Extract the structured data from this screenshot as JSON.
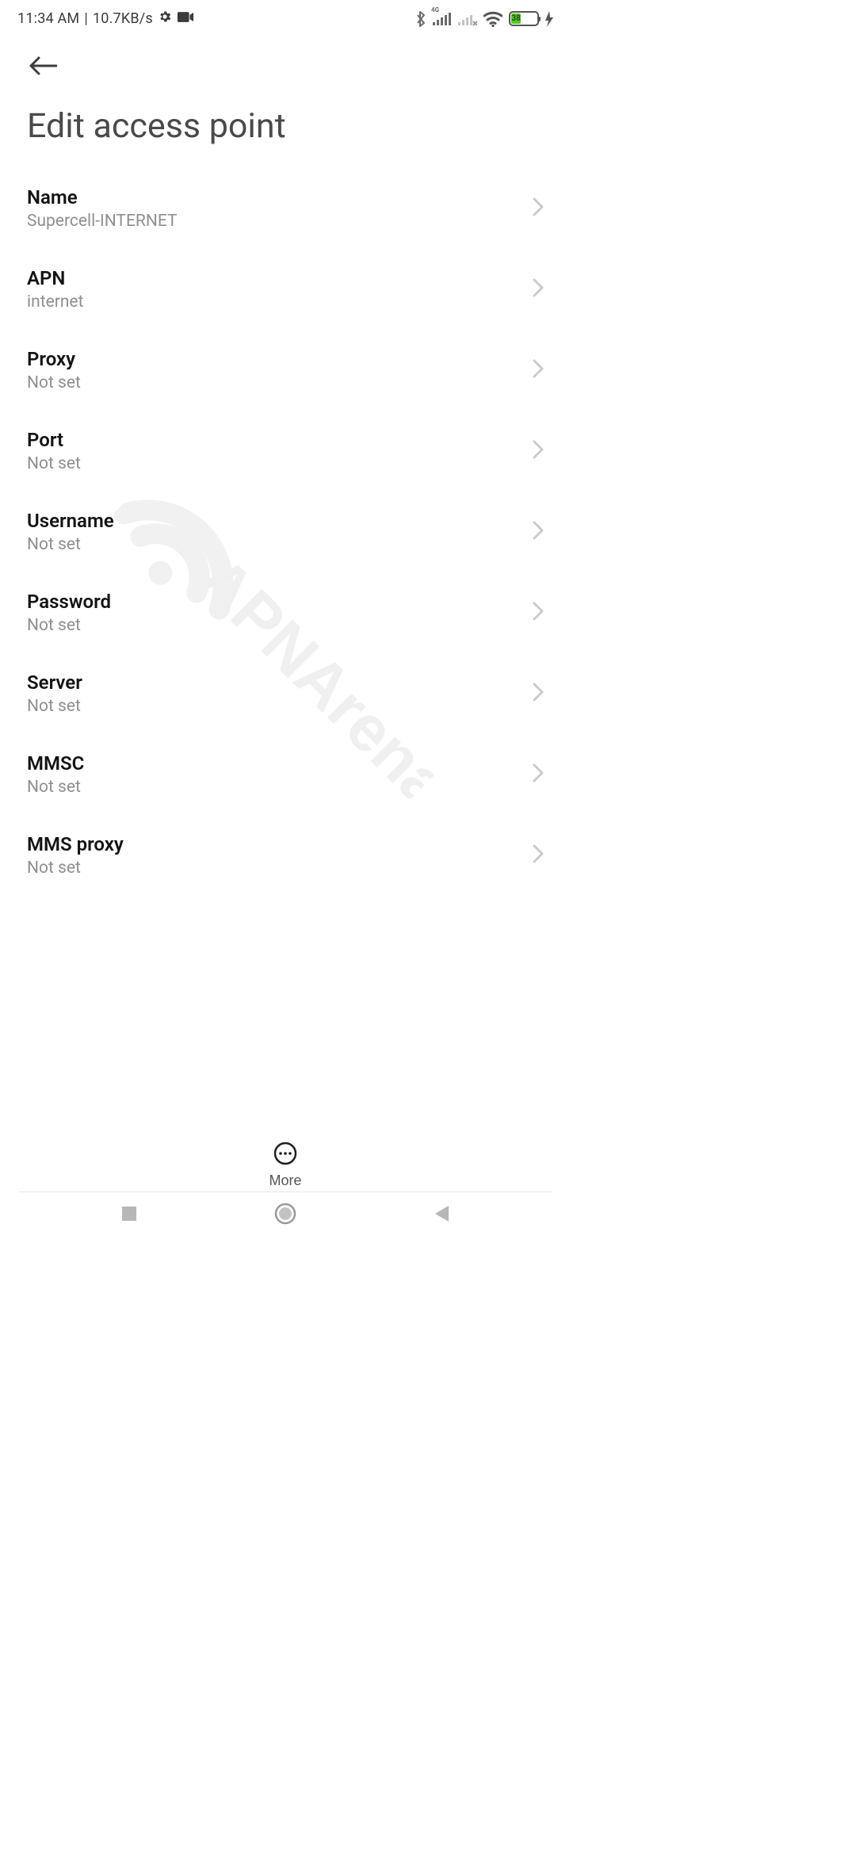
{
  "status": {
    "time": "11:34 AM",
    "separator": "|",
    "speed": "10.7KB/s",
    "battery_pct": 38,
    "battery_pct_text": "38",
    "network_badge": "4G"
  },
  "header": {
    "title": "Edit access point"
  },
  "rows": [
    {
      "label": "Name",
      "value": "Supercell-INTERNET"
    },
    {
      "label": "APN",
      "value": "internet"
    },
    {
      "label": "Proxy",
      "value": "Not set"
    },
    {
      "label": "Port",
      "value": "Not set"
    },
    {
      "label": "Username",
      "value": "Not set"
    },
    {
      "label": "Password",
      "value": "Not set"
    },
    {
      "label": "Server",
      "value": "Not set"
    },
    {
      "label": "MMSC",
      "value": "Not set"
    },
    {
      "label": "MMS proxy",
      "value": "Not set"
    }
  ],
  "bottom": {
    "more_label": "More"
  },
  "watermark_text": "APNArena"
}
